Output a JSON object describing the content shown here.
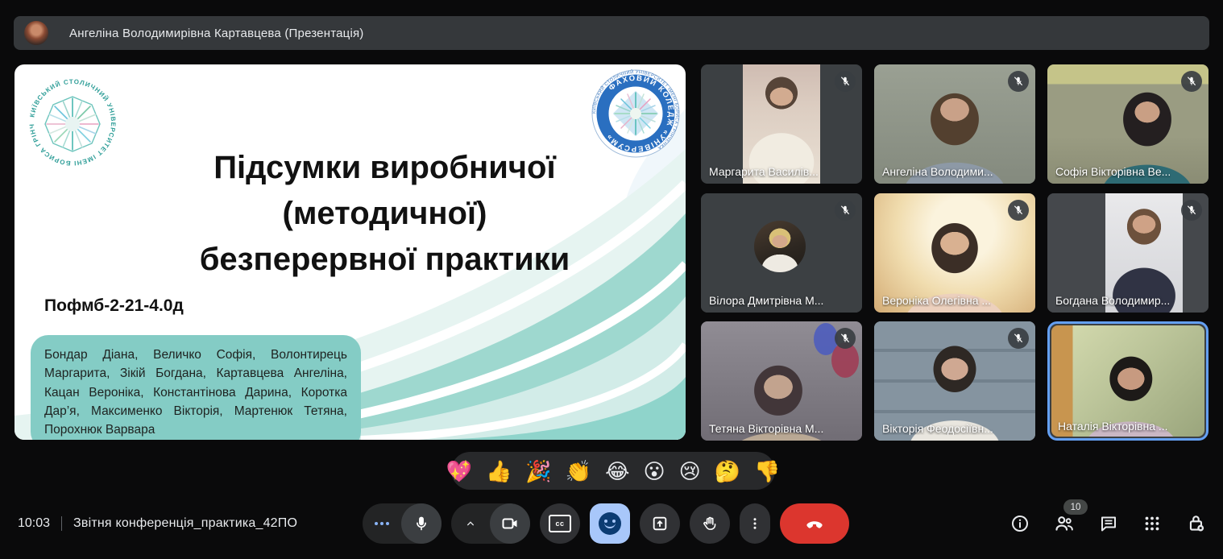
{
  "top_bar": {
    "presenter_label": "Ангеліна Володимирівна Картавцева (Презентація)"
  },
  "slide": {
    "logo_left_text": "КИЇВСЬКИЙ СТОЛИЧНИЙ УНІВЕРСИТЕТ ІМЕНІ БОРИСА ГРІНЧЕНКА",
    "logo_right_text": "ФАХОВИЙ КОЛЕДЖ «УНІВЕРСУМ»",
    "title_line1": "Підсумки виробничої",
    "title_line2": "(методичної)",
    "title_line3": "безперервної практики",
    "group": "Пофмб-2-21-4.0д",
    "students": "Бондар Діана, Величко Софія, Волонтирець Маргарита, Зікій Богдана, Картавцева Ангеліна, Кацан Вероніка, Константінова Дарина, Коротка Дар’я, Максименко Вікторія, Мартенюк Тетяна, Порохнюк Варвара"
  },
  "participants": [
    {
      "name": "Маргарита Василів...",
      "muted": true
    },
    {
      "name": "Ангеліна Володими...",
      "muted": true
    },
    {
      "name": "Софія Вікторівна Ве...",
      "muted": true
    },
    {
      "name": "Вілора Дмитрівна М...",
      "muted": true
    },
    {
      "name": "Вероніка Олегівна ...",
      "muted": true
    },
    {
      "name": "Богдана Володимир...",
      "muted": true
    },
    {
      "name": "Тетяна Вікторівна М...",
      "muted": true
    },
    {
      "name": "Вікторія Феодосіївн...",
      "muted": true
    },
    {
      "name": "Наталія Вікторівна ...",
      "muted": false,
      "active_speaker": true
    }
  ],
  "reactions": [
    "💖",
    "👍",
    "🎉",
    "👏",
    "😂",
    "😮",
    "😢",
    "🤔",
    "👎"
  ],
  "bottom_bar": {
    "time": "10:03",
    "meeting_name": "Звітня конференція_практика_42ПО",
    "participants_count": "10",
    "cc_label": "cc"
  },
  "colors": {
    "accent_blue": "#8ab4f8",
    "reaction_active_bg": "#a8c7fa",
    "end_call_red": "#dc362e",
    "speaker_border": "#64a0f4",
    "slide_box_teal": "#84ccc5"
  }
}
